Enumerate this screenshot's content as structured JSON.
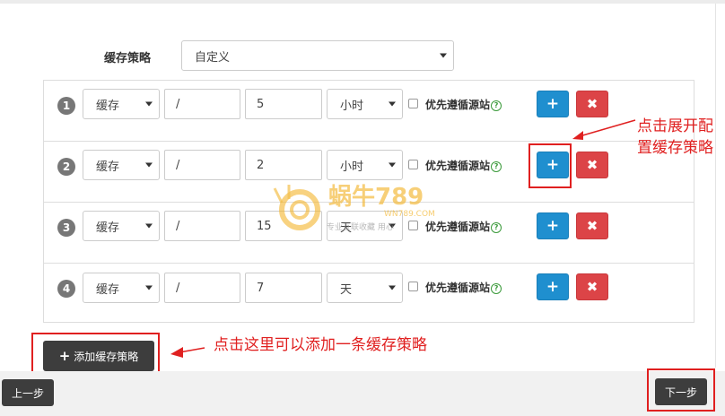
{
  "strategy": {
    "label": "缓存策略",
    "selected": "自定义"
  },
  "rules": [
    {
      "index": "1",
      "action": "缓存",
      "path": "/",
      "amount": "5",
      "unit": "小时",
      "priority_label": "优先遵循源站"
    },
    {
      "index": "2",
      "action": "缓存",
      "path": "/",
      "amount": "2",
      "unit": "小时",
      "priority_label": "优先遵循源站"
    },
    {
      "index": "3",
      "action": "缓存",
      "path": "/",
      "amount": "15",
      "unit": "天",
      "priority_label": "优先遵循源站"
    },
    {
      "index": "4",
      "action": "缓存",
      "path": "/",
      "amount": "7",
      "unit": "天",
      "priority_label": "优先遵循源站"
    }
  ],
  "buttons": {
    "add_icon": "+",
    "delete_icon": "✖",
    "help_icon": "?",
    "add_rule": "添加缓存策略",
    "prev": "上一步",
    "next": "下一步"
  },
  "annotations": {
    "expand_line1": "点击展开配",
    "expand_line2": "置缓存策略",
    "add_hint": "点击这里可以添加一条缓存策略"
  },
  "watermark": {
    "brand": "蜗牛789",
    "domain": "WN789.COM",
    "slogan": "专业互联收藏 用心"
  },
  "colors": {
    "primary": "#1f8fcf",
    "danger": "#dc4447",
    "dark_button": "#3d3d3d",
    "annotation": "#e02020"
  }
}
